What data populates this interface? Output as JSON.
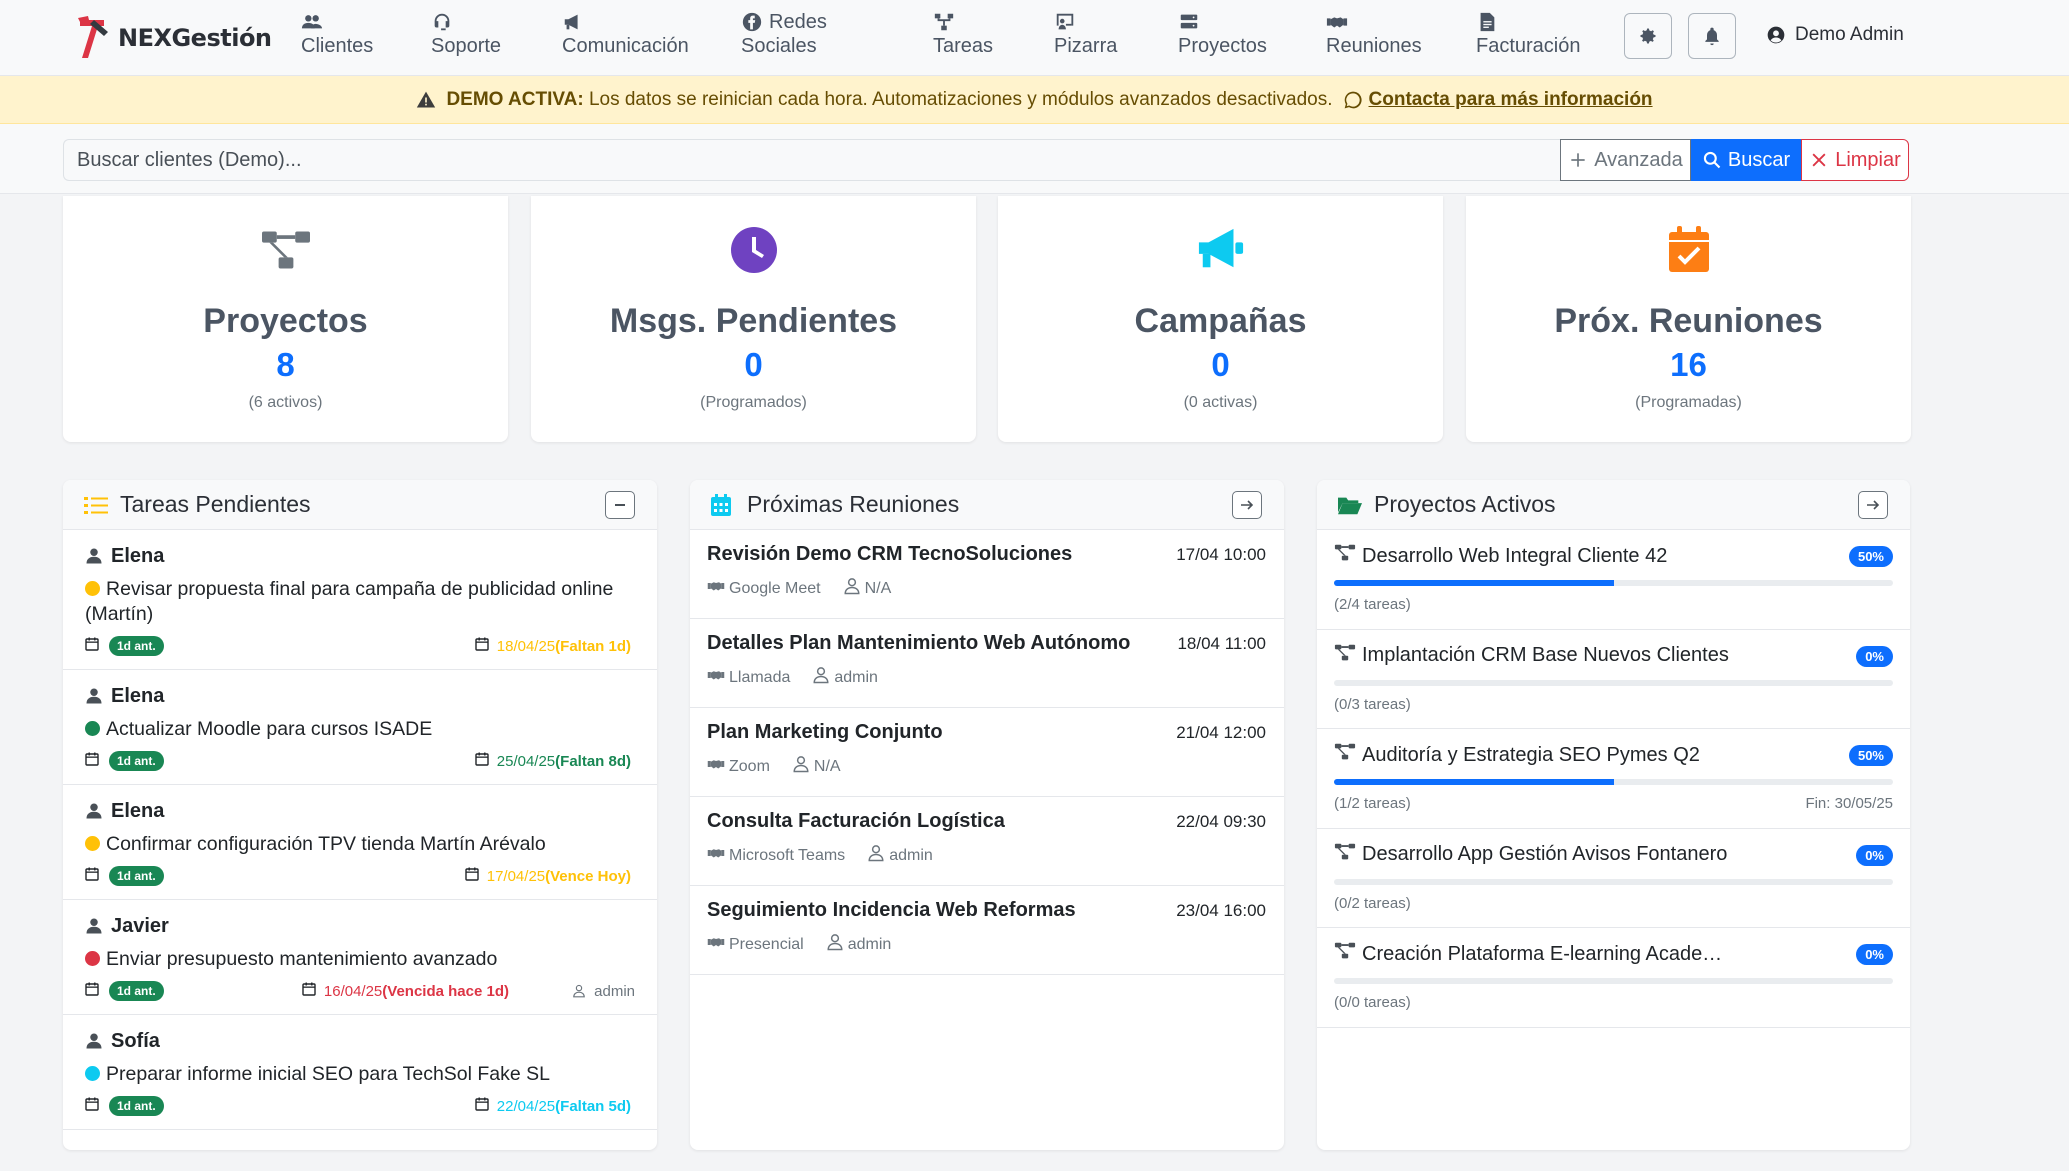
{
  "brand": {
    "name": "NEXGestión"
  },
  "nav": [
    {
      "label": "Clientes",
      "icon": "users-icon"
    },
    {
      "label": "Soporte",
      "icon": "headset-icon"
    },
    {
      "label": "Comunicación",
      "icon": "bullhorn-icon"
    },
    {
      "label": "Redes Sociales",
      "line1": "Redes",
      "line2": "Sociales",
      "icon": "facebook-icon"
    },
    {
      "label": "Tareas",
      "icon": "sitemap-icon"
    },
    {
      "label": "Pizarra",
      "icon": "chalkboard-icon"
    },
    {
      "label": "Proyectos",
      "icon": "server-icon"
    },
    {
      "label": "Reuniones",
      "icon": "handshake-icon"
    },
    {
      "label": "Facturación",
      "icon": "invoice-icon"
    }
  ],
  "user": {
    "name": "Demo Admin"
  },
  "banner": {
    "strong": "DEMO ACTIVA:",
    "text": "Los datos se reinician cada hora. Automatizaciones y módulos avanzados desactivados.",
    "link": "Contacta para más información",
    "color": "#664d03"
  },
  "search": {
    "placeholder": "Buscar clientes (Demo)...",
    "advanced": "Avanzada",
    "search": "Buscar",
    "clear": "Limpiar"
  },
  "stats": [
    {
      "title": "Proyectos",
      "value": "8",
      "sub": "(6 activos)",
      "icon": "project-diagram-icon",
      "color": "#6c757d"
    },
    {
      "title": "Msgs. Pendientes",
      "value": "0",
      "sub": "(Programados)",
      "icon": "clock-icon",
      "color": "#6f42c1"
    },
    {
      "title": "Campañas",
      "value": "0",
      "sub": "(0 activas)",
      "icon": "megaphone-icon",
      "color": "#0dcaf0"
    },
    {
      "title": "Próx. Reuniones",
      "value": "16",
      "sub": "(Programadas)",
      "icon": "calendar-check-icon",
      "color": "#fd7e14"
    }
  ],
  "tasks_panel": {
    "title": "Tareas Pendientes",
    "items": [
      {
        "user": "Elena",
        "desc": "Revisar propuesta final para campaña de publicidad online (Martín)",
        "dot": "#ffc107",
        "badge": "1d ant.",
        "date": "18/04/25",
        "status": "(Faltan 1d)",
        "color": "#ffc107",
        "assignee": ""
      },
      {
        "user": "Elena",
        "desc": "Actualizar Moodle para cursos ISADE",
        "dot": "#198754",
        "badge": "1d ant.",
        "date": "25/04/25",
        "status": "(Faltan 8d)",
        "color": "#198754",
        "assignee": ""
      },
      {
        "user": "Elena",
        "desc": "Confirmar configuración TPV tienda Martín Arévalo",
        "dot": "#ffc107",
        "badge": "1d ant.",
        "date": "17/04/25",
        "status": "(Vence Hoy)",
        "color": "#ffc107",
        "assignee": ""
      },
      {
        "user": "Javier",
        "desc": "Enviar presupuesto mantenimiento avanzado",
        "dot": "#dc3545",
        "badge": "1d ant.",
        "date": "16/04/25",
        "status": "(Vencida hace 1d)",
        "color": "#dc3545",
        "assignee": "admin"
      },
      {
        "user": "Sofía",
        "desc": "Preparar informe inicial SEO para TechSol Fake SL",
        "dot": "#0dcaf0",
        "badge": "1d ant.",
        "date": "22/04/25",
        "status": "(Faltan 5d)",
        "color": "#0dcaf0",
        "assignee": ""
      }
    ]
  },
  "meetings_panel": {
    "title": "Próximas Reuniones",
    "items": [
      {
        "title": "Revisión Demo CRM TecnoSoluciones",
        "time": "17/04 10:00",
        "type": "Google Meet",
        "host": "N/A"
      },
      {
        "title": "Detalles Plan Mantenimiento Web Autónomo",
        "time": "18/04 11:00",
        "type": "Llamada",
        "host": "admin"
      },
      {
        "title": "Plan Marketing Conjunto",
        "time": "21/04 12:00",
        "type": "Zoom",
        "host": "N/A"
      },
      {
        "title": "Consulta Facturación Logística",
        "time": "22/04 09:30",
        "type": "Microsoft Teams",
        "host": "admin"
      },
      {
        "title": "Seguimiento Incidencia Web Reformas",
        "time": "23/04 16:00",
        "type": "Presencial",
        "host": "admin"
      }
    ]
  },
  "projects_panel": {
    "title": "Proyectos Activos",
    "items": [
      {
        "title": "Desarrollo Web Integral Cliente 42",
        "percent": 50,
        "badge": "50%",
        "tasks": "(2/4 tareas)",
        "end": ""
      },
      {
        "title": "Implantación CRM Base Nuevos Clientes",
        "percent": 0,
        "badge": "0%",
        "tasks": "(0/3 tareas)",
        "end": ""
      },
      {
        "title": "Auditoría y Estrategia SEO Pymes Q2",
        "percent": 50,
        "badge": "50%",
        "tasks": "(1/2 tareas)",
        "end": "Fin: 30/05/25"
      },
      {
        "title": "Desarrollo App Gestión Avisos Fontanero",
        "percent": 0,
        "badge": "0%",
        "tasks": "(0/2 tareas)",
        "end": ""
      },
      {
        "title": "Creación Plataforma E-learning Acade…",
        "percent": 0,
        "badge": "0%",
        "tasks": "(0/0 tareas)",
        "end": ""
      }
    ]
  }
}
